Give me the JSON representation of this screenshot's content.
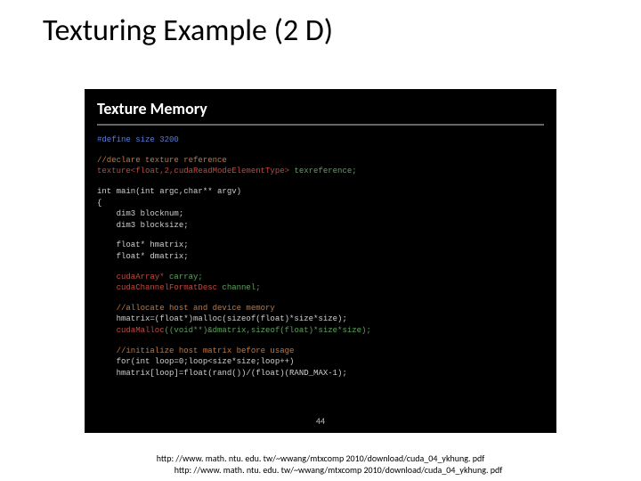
{
  "title": "Texturing Example (2 D)",
  "panel": {
    "heading": "Texture Memory",
    "lines": [
      {
        "cls": "kw-blue",
        "text": "#define size 3200"
      },
      {
        "cls": "blank",
        "text": ""
      },
      {
        "cls": "kw-orange",
        "text": "//declare texture reference"
      },
      {
        "cls": "mixed",
        "parts": [
          {
            "cls": "kw-red",
            "text": "texture<float,2,cudaReadModeElementType>"
          },
          {
            "cls": "kw-green",
            "text": " texreference;"
          }
        ]
      },
      {
        "cls": "blank",
        "text": ""
      },
      {
        "cls": "kw-white",
        "text": "int main(int argc,char** argv)"
      },
      {
        "cls": "kw-white",
        "text": "{"
      },
      {
        "cls": "kw-white",
        "text": "    dim3 blocknum;"
      },
      {
        "cls": "kw-white",
        "text": "    dim3 blocksize;"
      },
      {
        "cls": "blank",
        "text": ""
      },
      {
        "cls": "kw-white",
        "text": "    float* hmatrix;"
      },
      {
        "cls": "kw-white",
        "text": "    float* dmatrix;"
      },
      {
        "cls": "blank",
        "text": ""
      },
      {
        "cls": "mixed",
        "parts": [
          {
            "cls": "kw-red",
            "text": "    cudaArray*"
          },
          {
            "cls": "kw-green",
            "text": " carray;"
          }
        ]
      },
      {
        "cls": "mixed",
        "parts": [
          {
            "cls": "kw-red",
            "text": "    cudaChannelFormatDesc"
          },
          {
            "cls": "kw-green",
            "text": " channel;"
          }
        ]
      },
      {
        "cls": "blank",
        "text": ""
      },
      {
        "cls": "kw-orange",
        "text": "    //allocate host and device memory"
      },
      {
        "cls": "kw-white",
        "text": "    hmatrix=(float*)malloc(sizeof(float)*size*size);"
      },
      {
        "cls": "mixed",
        "parts": [
          {
            "cls": "kw-red",
            "text": "    cudaMalloc"
          },
          {
            "cls": "kw-green",
            "text": "((void**)&dmatrix,sizeof(float)*size*size);"
          }
        ]
      },
      {
        "cls": "blank",
        "text": ""
      },
      {
        "cls": "kw-orange",
        "text": "    //initialize host matrix before usage"
      },
      {
        "cls": "kw-white",
        "text": "    for(int loop=0;loop<size*size;loop++)"
      },
      {
        "cls": "kw-white",
        "text": "    hmatrix[loop]=float(rand())/(float)(RAND_MAX-1);"
      }
    ],
    "page_number": "44"
  },
  "footer": {
    "line1": "http: //www. math. ntu. edu. tw/~wwang/mtxcomp 2010/download/cuda_04_ykhung. pdf",
    "line2": "http: //www. math. ntu. edu. tw/~wwang/mtxcomp 2010/download/cuda_04_ykhung. pdf"
  }
}
